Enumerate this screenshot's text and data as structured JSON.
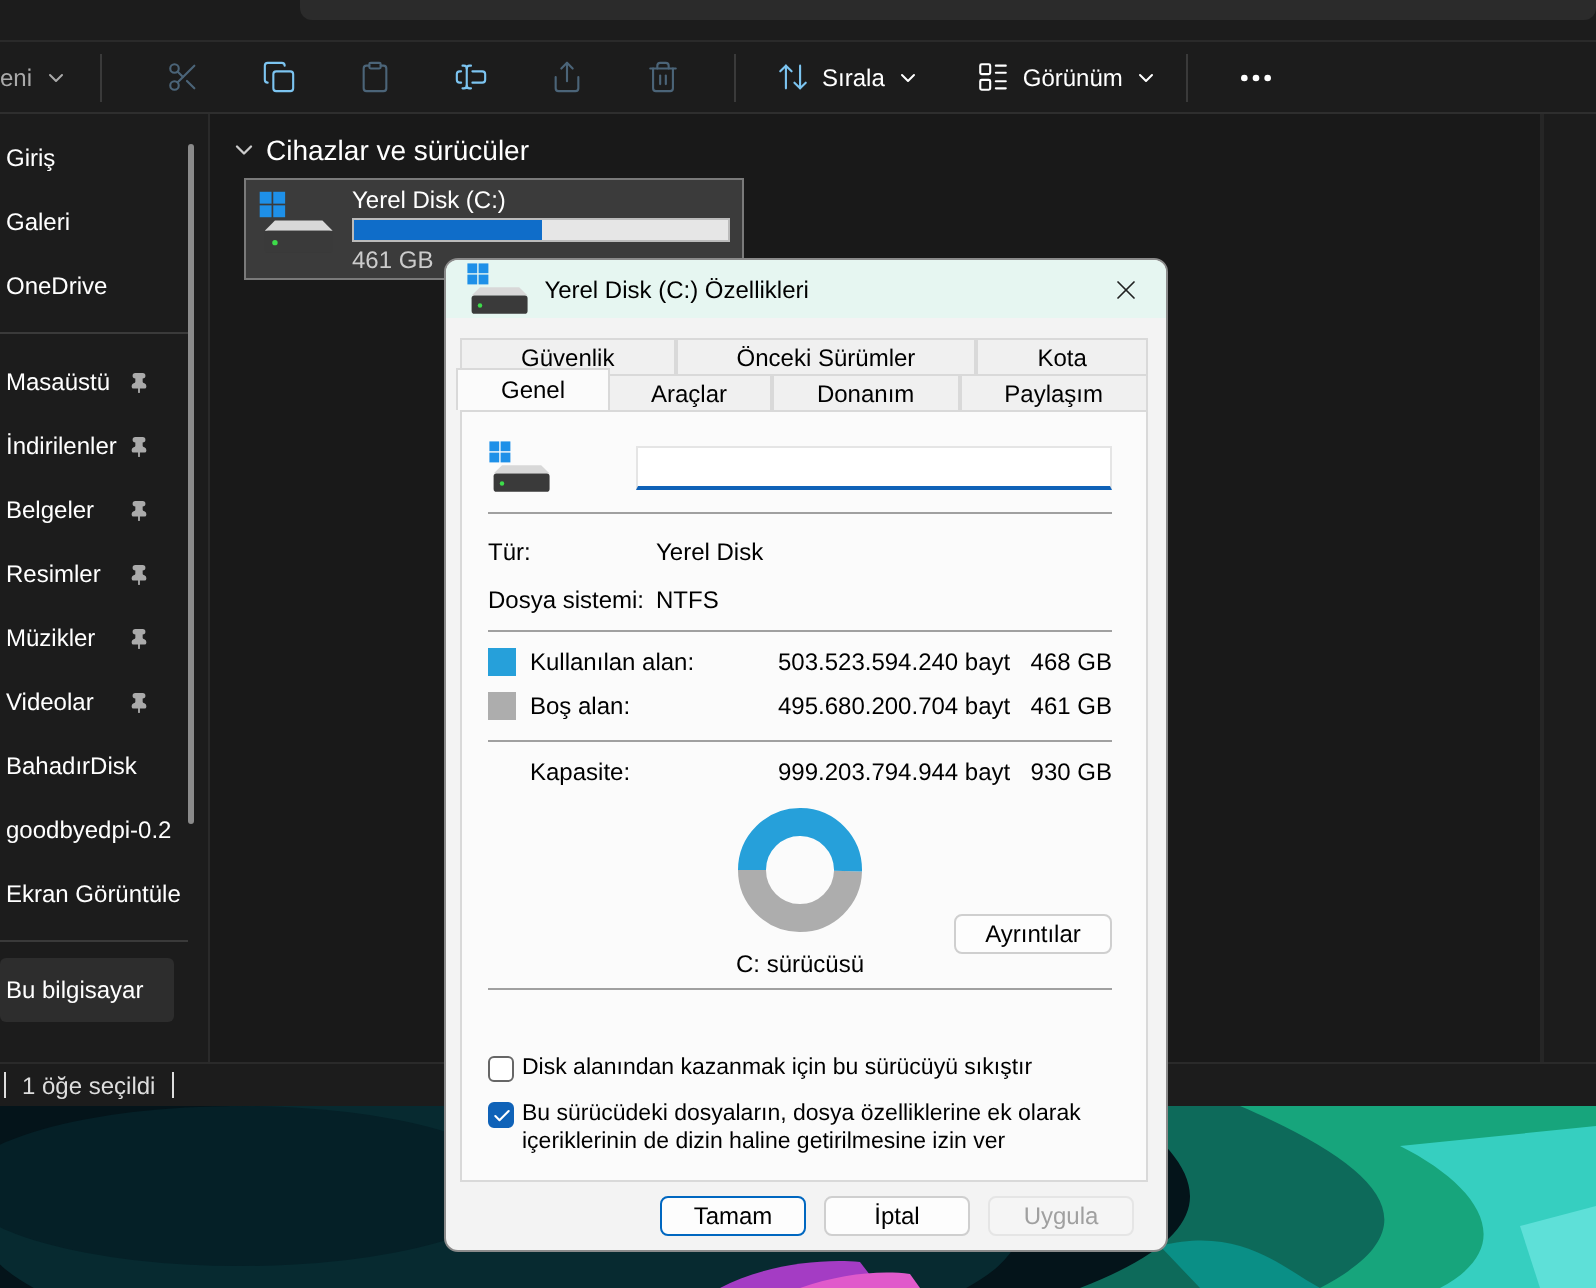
{
  "explorer": {
    "toolbar": {
      "new_label": "eni",
      "actions": [
        {
          "kind": "cut",
          "disabled": true
        },
        {
          "kind": "copy",
          "disabled": false
        },
        {
          "kind": "paste",
          "disabled": true
        },
        {
          "kind": "rename",
          "disabled": false
        },
        {
          "kind": "share",
          "disabled": true
        },
        {
          "kind": "delete",
          "disabled": true
        }
      ],
      "sort_label": "Sırala",
      "view_label": "Görünüm"
    },
    "sidebar": {
      "groups": [
        {
          "items": [
            {
              "label": "Giriş",
              "pinned": false,
              "selected": false
            },
            {
              "label": "Galeri",
              "pinned": false,
              "selected": false
            },
            {
              "label": "OneDrive",
              "pinned": false,
              "selected": false
            }
          ]
        },
        {
          "items": [
            {
              "label": "Masaüstü",
              "pinned": true,
              "selected": false
            },
            {
              "label": "İndirilenler",
              "pinned": true,
              "selected": false
            },
            {
              "label": "Belgeler",
              "pinned": true,
              "selected": false
            },
            {
              "label": "Resimler",
              "pinned": true,
              "selected": false
            },
            {
              "label": "Müzikler",
              "pinned": true,
              "selected": false
            },
            {
              "label": "Videolar",
              "pinned": true,
              "selected": false
            },
            {
              "label": "BahadırDisk",
              "pinned": false,
              "selected": false
            },
            {
              "label": "goodbyedpi-0.2",
              "pinned": false,
              "selected": false
            },
            {
              "label": "Ekran Görüntüle",
              "pinned": false,
              "selected": false
            }
          ]
        },
        {
          "items": [
            {
              "label": "Bu bilgisayar",
              "pinned": false,
              "selected": true
            }
          ]
        }
      ]
    },
    "section": {
      "title": "Cihazlar ve sürücüler",
      "expanded": true
    },
    "drives": [
      {
        "name": "Yerel Disk (C:)",
        "level": 0.5,
        "free_text": "461 GB",
        "selected": true
      }
    ],
    "status_bar": "1 öğe seçildi"
  },
  "dialog": {
    "title": "Yerel Disk (C:) Özellikleri",
    "tab_rows": [
      [
        {
          "label": "Güvenlik",
          "selected": false
        },
        {
          "label": "Önceki Sürümler",
          "selected": false
        },
        {
          "label": "Kota",
          "selected": false
        }
      ],
      [
        {
          "label": "Genel",
          "selected": true
        },
        {
          "label": "Araçlar",
          "selected": false
        },
        {
          "label": "Donanım",
          "selected": false
        },
        {
          "label": "Paylaşım",
          "selected": false
        }
      ]
    ],
    "info": [
      {
        "label": "Tür:",
        "value": "Yerel Disk"
      },
      {
        "label": "Dosya sistemi:",
        "value": "NTFS"
      }
    ],
    "space": [
      {
        "label": "Kullanılan alan:",
        "bytes": "503.523.594.240 bayt",
        "size": "468 GB",
        "color": "#26a0da"
      },
      {
        "label": "Boş alan:",
        "bytes": "495.680.200.704 bayt",
        "size": "461 GB",
        "color": "#adadad"
      }
    ],
    "capacity": {
      "label": "Kapasite:",
      "bytes": "999.203.794.944 bayt",
      "size": "930 GB"
    },
    "usage_chart": {
      "caption": "C: sürücüsü"
    },
    "details_button": "Ayrıntılar",
    "options": [
      {
        "label": "Disk alanından kazanmak için bu sürücüyü sıkıştır",
        "checked": false
      },
      {
        "label": "Bu sürücüdeki dosyaların, dosya özelliklerine ek olarak içeriklerinin de dizin haline getirilmesine izin ver",
        "checked": true
      }
    ],
    "buttons": [
      {
        "label": "Tamam",
        "kind": "default",
        "disabled": false
      },
      {
        "label": "İptal",
        "kind": "normal",
        "disabled": false
      },
      {
        "label": "Uygula",
        "kind": "normal",
        "disabled": true
      }
    ]
  }
}
